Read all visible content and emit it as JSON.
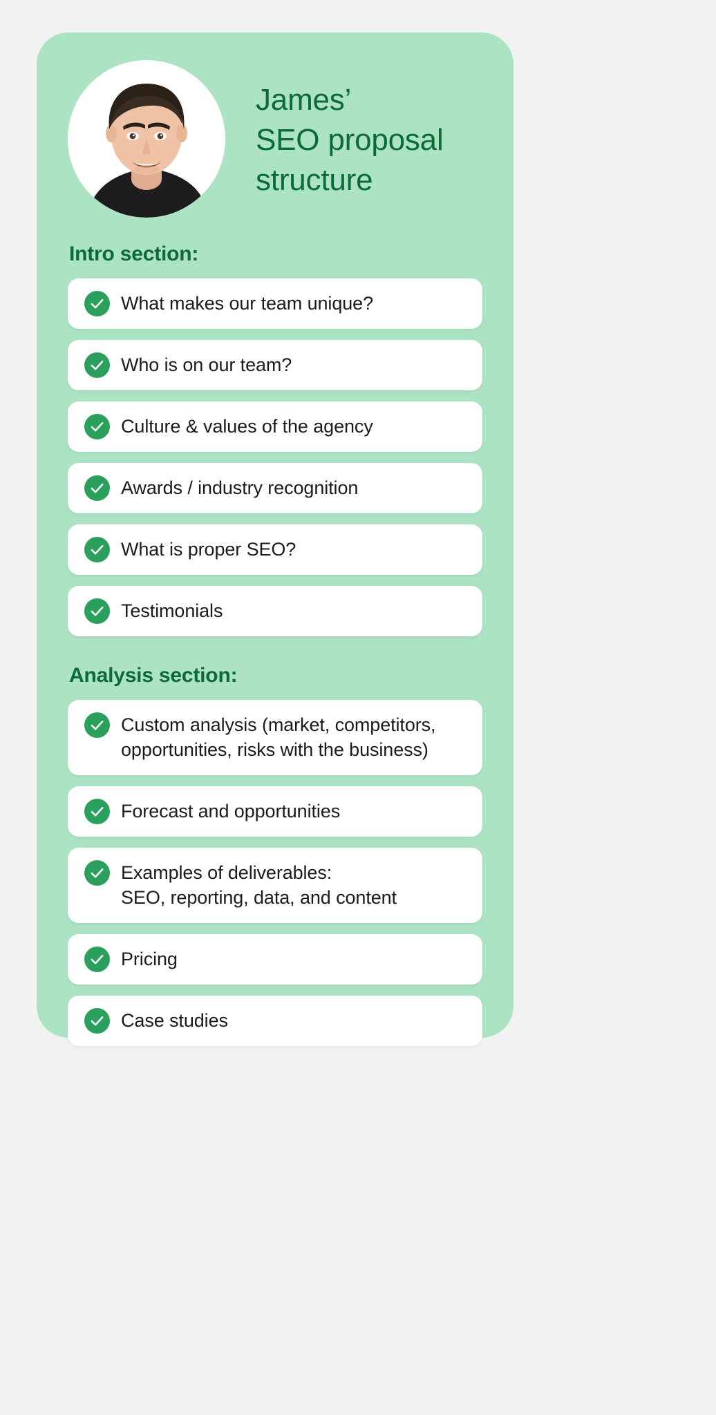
{
  "theme": {
    "page_background": "#f1f3f3",
    "card_background": "#abe3c3",
    "heading_green": "#0c6b34",
    "check_green": "#2aa05c",
    "item_background": "#ffffff",
    "item_text": "#181c1c"
  },
  "header": {
    "avatar_alt": "James",
    "title": "James’\nSEO proposal\nstructure"
  },
  "sections": [
    {
      "heading": "Intro section:",
      "items": [
        {
          "label": "What makes our team unique?"
        },
        {
          "label": "Who is on our team?"
        },
        {
          "label": "Culture & values of the agency"
        },
        {
          "label": "Awards / industry recognition"
        },
        {
          "label": "What is proper SEO?"
        },
        {
          "label": "Testimonials"
        }
      ]
    },
    {
      "heading": "Analysis section:",
      "items": [
        {
          "label": "Custom analysis (market, competitors,\nopportunities, risks with the business)"
        },
        {
          "label": "Forecast and opportunities"
        },
        {
          "label": "Examples of deliverables:\nSEO, reporting, data, and content"
        },
        {
          "label": "Pricing"
        },
        {
          "label": "Case studies"
        }
      ]
    }
  ]
}
